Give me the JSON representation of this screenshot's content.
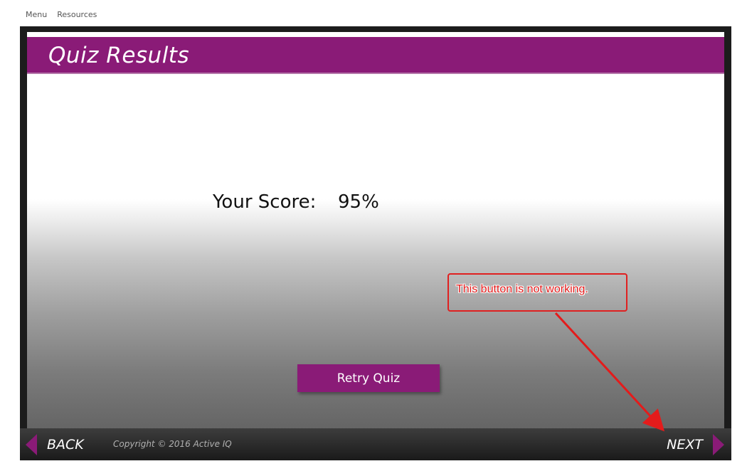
{
  "topnav": {
    "menu": "Menu",
    "resources": "Resources"
  },
  "slide": {
    "title": "Quiz Results",
    "score_label": "Your Score:",
    "score_value": "95%",
    "retry_button": "Retry Quiz"
  },
  "footer": {
    "back": "BACK",
    "copyright": "Copyright © 2016 Active IQ",
    "next": "NEXT"
  },
  "annotation": {
    "text": "This button is not working."
  },
  "colors": {
    "accent": "#8a1b77",
    "annotation": "#e41b1b"
  },
  "icons": {
    "back": "triangle-left-icon",
    "next": "triangle-right-icon"
  }
}
